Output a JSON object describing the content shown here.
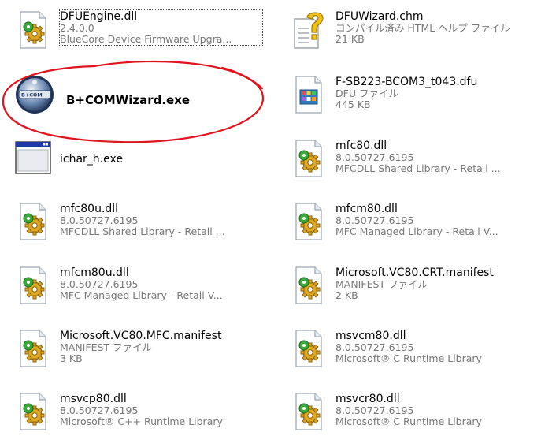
{
  "files": [
    {
      "id": "dfuengine-dll",
      "name": "DFUEngine.dll",
      "meta1": "2.4.0.0",
      "meta2": "BlueCore Device Firmware Upgra...",
      "icon": "dll-icon"
    },
    {
      "id": "dfuwizard-chm",
      "name": "DFUWizard.chm",
      "meta1": "コンパイル済み HTML ヘルプ ファイル",
      "meta2": "21 KB",
      "icon": "chm-help-icon"
    },
    {
      "id": "bcomwizard-exe",
      "name": "B+COMWizard.exe",
      "meta1": "",
      "meta2": "",
      "icon": "bcom-app-icon",
      "bold": true
    },
    {
      "id": "f-sb223-dfu",
      "name": "F-SB223-BCOM3_t043.dfu",
      "meta1": "DFU ファイル",
      "meta2": "445 KB",
      "icon": "dfu-file-icon"
    },
    {
      "id": "ichar-exe",
      "name": "ichar_h.exe",
      "meta1": "",
      "meta2": "",
      "icon": "exe-window-icon"
    },
    {
      "id": "mfc80-dll",
      "name": "mfc80.dll",
      "meta1": "8.0.50727.6195",
      "meta2": "MFCDLL Shared Library - Retail ...",
      "icon": "dll-icon"
    },
    {
      "id": "mfc80u-dll",
      "name": "mfc80u.dll",
      "meta1": "8.0.50727.6195",
      "meta2": "MFCDLL Shared Library - Retail ...",
      "icon": "dll-icon"
    },
    {
      "id": "mfcm80-dll",
      "name": "mfcm80.dll",
      "meta1": "8.0.50727.6195",
      "meta2": "MFC Managed Library - Retail V...",
      "icon": "dll-icon"
    },
    {
      "id": "mfcm80u-dll",
      "name": "mfcm80u.dll",
      "meta1": "8.0.50727.6195",
      "meta2": "MFC Managed Library - Retail V...",
      "icon": "dll-icon"
    },
    {
      "id": "vc80-crt-manifest",
      "name": "Microsoft.VC80.CRT.manifest",
      "meta1": "MANIFEST ファイル",
      "meta2": "2 KB",
      "icon": "dll-icon"
    },
    {
      "id": "vc80-mfc-manifest",
      "name": "Microsoft.VC80.MFC.manifest",
      "meta1": "MANIFEST ファイル",
      "meta2": "3 KB",
      "icon": "dll-icon"
    },
    {
      "id": "msvcm80-dll",
      "name": "msvcm80.dll",
      "meta1": "8.0.50727.6195",
      "meta2": "Microsoft® C Runtime Library",
      "icon": "dll-icon"
    },
    {
      "id": "msvcp80-dll",
      "name": "msvcp80.dll",
      "meta1": "8.0.50727.6195",
      "meta2": "Microsoft® C++ Runtime Library",
      "icon": "dll-icon"
    },
    {
      "id": "msvcr80-dll",
      "name": "msvcr80.dll",
      "meta1": "8.0.50727.6195",
      "meta2": "Microsoft® C Runtime Library",
      "icon": "dll-icon"
    }
  ],
  "annotation": {
    "color": "#e0141e",
    "target": "B+COMWizard.exe"
  }
}
